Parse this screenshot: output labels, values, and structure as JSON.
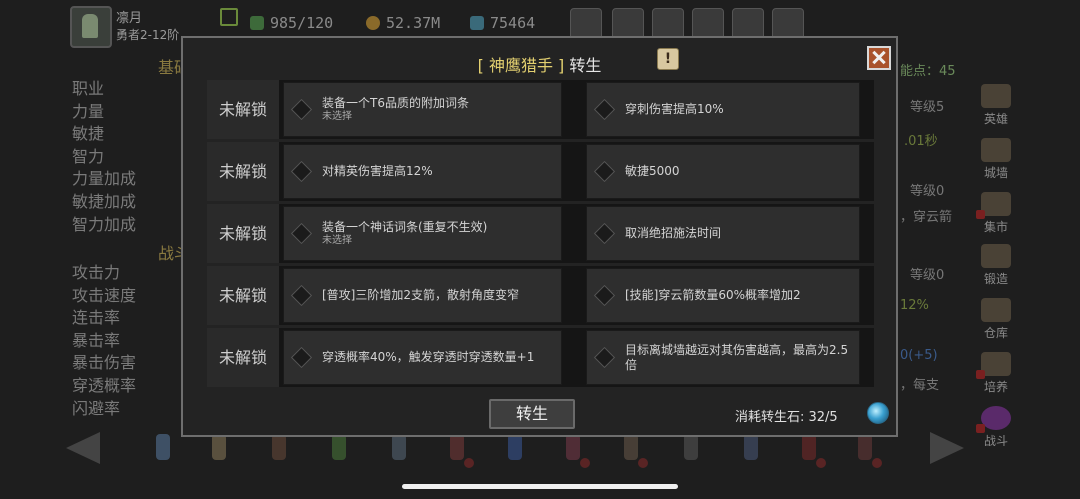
{
  "player": {
    "name": "凛月",
    "rank": "勇者2-12阶"
  },
  "resources": {
    "energy": "985/120",
    "gold": "52.37M",
    "gems": "75464"
  },
  "background": {
    "section1": "基础",
    "section2": "战斗",
    "stats1": [
      "职业",
      "力量",
      "敏捷",
      "智力",
      "力量加成",
      "敏捷加成",
      "智力加成"
    ],
    "stats2": [
      "攻击力",
      "攻击速度",
      "连击率",
      "暴击率",
      "暴击伤害",
      "穿透概率",
      "闪避率"
    ],
    "skill_points": "能点：45",
    "right_texts": [
      "等级5",
      ".01秒",
      "等级0",
      "，穿云箭",
      "等级0",
      "12%",
      "0(+5)",
      "，每支"
    ],
    "side_buttons": [
      "英雄",
      "城墙",
      "集市",
      "锻造",
      "仓库",
      "培养",
      "战斗"
    ]
  },
  "modal": {
    "title_bracket_open": "[",
    "class_name": "神鹰猎手",
    "title_bracket_close": "]",
    "title_suffix": "转生",
    "info_label": "!",
    "rows": [
      {
        "lock": "未解锁",
        "a": "装备一个T6品质的附加词条",
        "a_sub": "未选择",
        "b": "穿刺伤害提高10%"
      },
      {
        "lock": "未解锁",
        "a": "对精英伤害提高12%",
        "b": "敏捷5000"
      },
      {
        "lock": "未解锁",
        "a": "装备一个神话词条(重复不生效)",
        "a_sub": "未选择",
        "b": "取消绝招施法时间"
      },
      {
        "lock": "未解锁",
        "a": "[普攻]三阶增加2支箭，散射角度变窄",
        "b": "[技能]穿云箭数量60%概率增加2"
      },
      {
        "lock": "未解锁",
        "a": "穿透概率40%，触发穿透时穿透数量+1",
        "b": "目标离城墙越远对其伤害越高，最高为2.5倍"
      }
    ],
    "rebirth_button": "转生",
    "cost_text": "消耗转生石:  32/5"
  },
  "colors": {
    "class_name": "#e3d070",
    "close_button": "#a9522b",
    "modal_bg": "#232323"
  }
}
